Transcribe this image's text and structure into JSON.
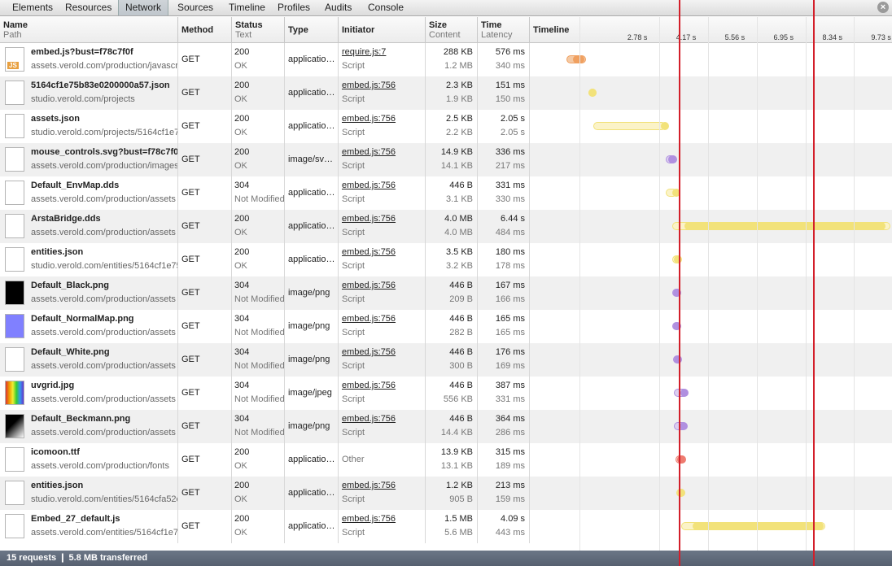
{
  "tabs": [
    "Elements",
    "Resources",
    "Network",
    "Sources",
    "Timeline",
    "Profiles",
    "Audits",
    "Console"
  ],
  "selected_tab": "Network",
  "columns": {
    "name": {
      "title": "Name",
      "sub": "Path"
    },
    "method": {
      "title": "Method"
    },
    "status": {
      "title": "Status",
      "sub": "Text"
    },
    "type": {
      "title": "Type"
    },
    "initiator": {
      "title": "Initiator"
    },
    "size": {
      "title": "Size",
      "sub": "Content"
    },
    "time": {
      "title": "Time",
      "sub": "Latency"
    },
    "timeline": {
      "title": "Timeline"
    }
  },
  "timeline_ticks": [
    "2.78 s",
    "4.17 s",
    "5.56 s",
    "6.95 s",
    "8.34 s",
    "9.73 s"
  ],
  "colors": {
    "orange": [
      "#f4c9a4",
      "#f0a060"
    ],
    "yellow": [
      "#fbf3c8",
      "#f2e27a"
    ],
    "purple": [
      "#dcd0f0",
      "#b090e0"
    ],
    "red": [
      "#f8cfc8",
      "#ee7a6e"
    ],
    "marker": "#d31f2a"
  },
  "requests": [
    {
      "name": "embed.js?bust=f78c7f0f",
      "path": "assets.verold.com/production/javascripts",
      "icon": "js",
      "method": "GET",
      "status": "200",
      "status_text": "OK",
      "type": "applicatio…",
      "initiator": "require.js:7",
      "initiator_type": "Script",
      "size": "288 KB",
      "content": "1.2 MB",
      "time": "576 ms",
      "latency": "340 ms",
      "bar": {
        "start": 0.2,
        "wait": 0.34,
        "total": 0.576,
        "color": "orange"
      }
    },
    {
      "name": "5164cf1e75b83e0200000a57.json",
      "path": "studio.verold.com/projects",
      "icon": "doc",
      "method": "GET",
      "status": "200",
      "status_text": "OK",
      "type": "applicatio…",
      "initiator": "embed.js:756",
      "initiator_type": "Script",
      "size": "2.3 KB",
      "content": "1.9 KB",
      "time": "151 ms",
      "latency": "150 ms",
      "bar": {
        "start": 0.83,
        "wait": 0.15,
        "total": 0.151,
        "color": "yellow"
      }
    },
    {
      "name": "assets.json",
      "path": "studio.verold.com/projects/5164cf1e75b83e0200000a57",
      "icon": "doc",
      "method": "GET",
      "status": "200",
      "status_text": "OK",
      "type": "applicatio…",
      "initiator": "embed.js:756",
      "initiator_type": "Script",
      "size": "2.5 KB",
      "content": "2.2 KB",
      "time": "2.05 s",
      "latency": "2.05 s",
      "bar": {
        "start": 0.98,
        "wait": 2.05,
        "total": 2.05,
        "color": "yellow"
      }
    },
    {
      "name": "mouse_controls.svg?bust=f78c7f0f",
      "path": "assets.verold.com/production/images",
      "icon": "svg",
      "method": "GET",
      "status": "200",
      "status_text": "OK",
      "type": "image/sv…",
      "initiator": "embed.js:756",
      "initiator_type": "Script",
      "size": "14.9 KB",
      "content": "14.1 KB",
      "time": "336 ms",
      "latency": "217 ms",
      "bar": {
        "start": 3.03,
        "wait": 0.217,
        "total": 0.336,
        "color": "purple"
      }
    },
    {
      "name": "Default_EnvMap.dds",
      "path": "assets.verold.com/production/assets",
      "icon": "doc",
      "method": "GET",
      "status": "304",
      "status_text": "Not Modified",
      "type": "applicatio…",
      "initiator": "embed.js:756",
      "initiator_type": "Script",
      "size": "446 B",
      "content": "3.1 KB",
      "time": "331 ms",
      "latency": "330 ms",
      "bar": {
        "start": 3.04,
        "wait": 0.33,
        "total": 0.331,
        "color": "yellow"
      }
    },
    {
      "name": "ArstaBridge.dds",
      "path": "assets.verold.com/production/assets",
      "icon": "doc",
      "method": "GET",
      "status": "200",
      "status_text": "OK",
      "type": "applicatio…",
      "initiator": "embed.js:756",
      "initiator_type": "Script",
      "size": "4.0 MB",
      "content": "4.0 MB",
      "time": "6.44 s",
      "latency": "484 ms",
      "bar": {
        "start": 3.22,
        "wait": 0.484,
        "total": 6.44,
        "color": "yellow"
      }
    },
    {
      "name": "entities.json",
      "path": "studio.verold.com/entities/5164cf1e75b83e0200000a58",
      "icon": "doc",
      "method": "GET",
      "status": "200",
      "status_text": "OK",
      "type": "applicatio…",
      "initiator": "embed.js:756",
      "initiator_type": "Script",
      "size": "3.5 KB",
      "content": "3.2 KB",
      "time": "180 ms",
      "latency": "178 ms",
      "bar": {
        "start": 3.23,
        "wait": 0.178,
        "total": 0.18,
        "color": "yellow"
      }
    },
    {
      "name": "Default_Black.png",
      "path": "assets.verold.com/production/assets",
      "icon": "black",
      "method": "GET",
      "status": "304",
      "status_text": "Not Modified",
      "type": "image/png",
      "initiator": "embed.js:756",
      "initiator_type": "Script",
      "size": "446 B",
      "content": "209 B",
      "time": "167 ms",
      "latency": "166 ms",
      "bar": {
        "start": 3.23,
        "wait": 0.166,
        "total": 0.167,
        "color": "purple"
      }
    },
    {
      "name": "Default_NormalMap.png",
      "path": "assets.verold.com/production/assets",
      "icon": "blue",
      "method": "GET",
      "status": "304",
      "status_text": "Not Modified",
      "type": "image/png",
      "initiator": "embed.js:756",
      "initiator_type": "Script",
      "size": "446 B",
      "content": "282 B",
      "time": "165 ms",
      "latency": "165 ms",
      "bar": {
        "start": 3.23,
        "wait": 0.165,
        "total": 0.165,
        "color": "purple"
      }
    },
    {
      "name": "Default_White.png",
      "path": "assets.verold.com/production/assets",
      "icon": "doc",
      "method": "GET",
      "status": "304",
      "status_text": "Not Modified",
      "type": "image/png",
      "initiator": "embed.js:756",
      "initiator_type": "Script",
      "size": "446 B",
      "content": "300 B",
      "time": "176 ms",
      "latency": "169 ms",
      "bar": {
        "start": 3.24,
        "wait": 0.169,
        "total": 0.176,
        "color": "purple"
      }
    },
    {
      "name": "uvgrid.jpg",
      "path": "assets.verold.com/production/assets",
      "icon": "grid",
      "method": "GET",
      "status": "304",
      "status_text": "Not Modified",
      "type": "image/jpeg",
      "initiator": "embed.js:756",
      "initiator_type": "Script",
      "size": "446 B",
      "content": "556 KB",
      "time": "387 ms",
      "latency": "331 ms",
      "bar": {
        "start": 3.27,
        "wait": 0.331,
        "total": 0.387,
        "color": "purple"
      }
    },
    {
      "name": "Default_Beckmann.png",
      "path": "assets.verold.com/production/assets",
      "icon": "beck",
      "method": "GET",
      "status": "304",
      "status_text": "Not Modified",
      "type": "image/png",
      "initiator": "embed.js:756",
      "initiator_type": "Script",
      "size": "446 B",
      "content": "14.4 KB",
      "time": "364 ms",
      "latency": "286 ms",
      "bar": {
        "start": 3.28,
        "wait": 0.286,
        "total": 0.364,
        "color": "purple"
      }
    },
    {
      "name": "icomoon.ttf",
      "path": "assets.verold.com/production/fonts",
      "icon": "doc",
      "method": "GET",
      "status": "200",
      "status_text": "OK",
      "type": "applicatio…",
      "initiator": "Other",
      "initiator_type": "",
      "size": "13.9 KB",
      "content": "13.1 KB",
      "time": "315 ms",
      "latency": "189 ms",
      "bar": {
        "start": 3.31,
        "wait": 0.189,
        "total": 0.315,
        "color": "red"
      }
    },
    {
      "name": "entities.json",
      "path": "studio.verold.com/entities/5164cfa52c6f120200000a41",
      "icon": "doc",
      "method": "GET",
      "status": "200",
      "status_text": "OK",
      "type": "applicatio…",
      "initiator": "embed.js:756",
      "initiator_type": "Script",
      "size": "1.2 KB",
      "content": "905 B",
      "time": "213 ms",
      "latency": "159 ms",
      "bar": {
        "start": 3.35,
        "wait": 0.159,
        "total": 0.213,
        "color": "yellow"
      }
    },
    {
      "name": "Embed_27_default.js",
      "path": "assets.verold.com/entities/5164cf1e75b83e0200000a58",
      "icon": "doc",
      "method": "GET",
      "status": "200",
      "status_text": "OK",
      "type": "applicatio…",
      "initiator": "embed.js:756",
      "initiator_type": "Script",
      "size": "1.5 MB",
      "content": "5.6 MB",
      "time": "4.09 s",
      "latency": "443 ms",
      "bar": {
        "start": 3.49,
        "wait": 0.443,
        "total": 4.09,
        "color": "yellow"
      }
    }
  ],
  "summary": "15 requests  ❙  5.8 MB transferred"
}
